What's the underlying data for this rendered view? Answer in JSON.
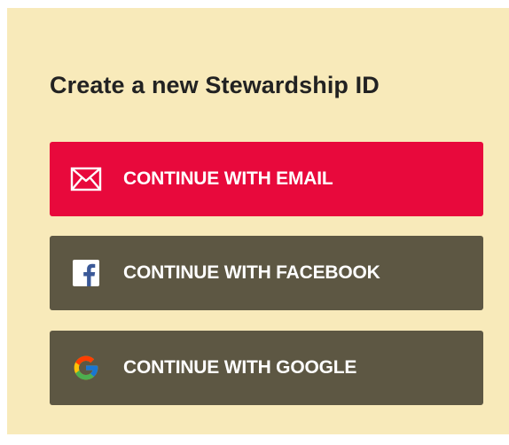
{
  "title": "Create a new Stewardship ID",
  "colors": {
    "panel_background": "#f8eaba",
    "email_button": "#e8093c",
    "social_button": "#5d5743",
    "title_text": "#222222",
    "button_text": "#ffffff"
  },
  "buttons": {
    "email": {
      "label": "CONTINUE WITH EMAIL",
      "icon": "envelope-icon"
    },
    "facebook": {
      "label": "CONTINUE WITH FACEBOOK",
      "icon": "facebook-icon"
    },
    "google": {
      "label": "CONTINUE WITH GOOGLE",
      "icon": "google-icon"
    }
  }
}
